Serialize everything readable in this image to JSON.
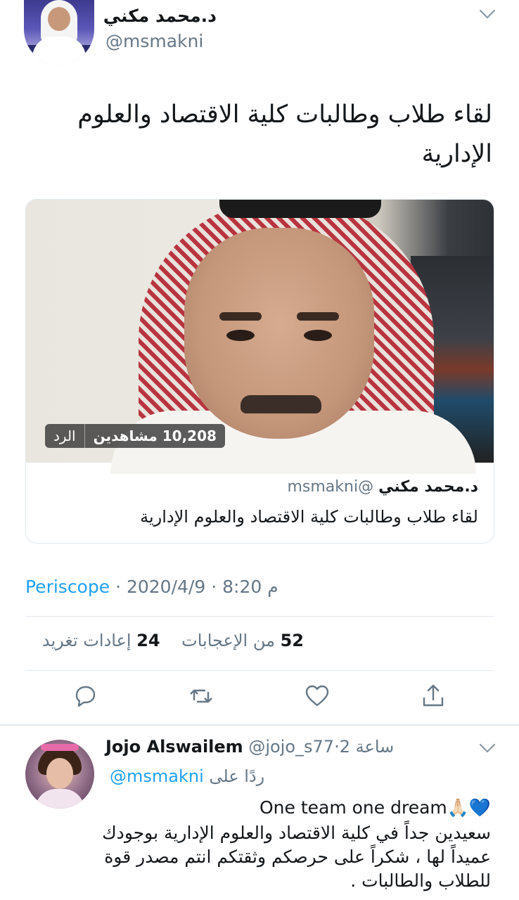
{
  "main_tweet": {
    "author_name": "د.محمد مكني",
    "author_handle": "@msmakni",
    "text": "لقاء طلاب وطالبات كلية الاقتصاد والعلوم الإدارية",
    "menu_icon": "chevron-down-icon"
  },
  "video_card": {
    "views": "10,208 مشاهدين",
    "reply_label": "الرد",
    "author_name": "د.محمد مكني",
    "author_handle": "@msmakni",
    "title": "لقاء طلاب وطالبات كلية الاقتصاد والعلوم الإدارية"
  },
  "meta": {
    "time": "8:20 م",
    "separator": "·",
    "date": "2020/4/9",
    "source": "Periscope"
  },
  "stats": {
    "likes_count": "52",
    "likes_label": "من الإعجابات",
    "retweets_count": "24",
    "retweets_label": "إعادات تغريد"
  },
  "actions": [
    {
      "icon": "reply-icon"
    },
    {
      "icon": "retweet-icon"
    },
    {
      "icon": "like-icon"
    },
    {
      "icon": "share-icon"
    }
  ],
  "reply": {
    "author_name": "Jojo Alswailem",
    "author_handle": "@jojo_s77",
    "separator": "·",
    "time": "2 ساعة",
    "replying_to_label": "ردًا على",
    "replying_to_handle": "@msmakni",
    "line1": "One team one dream🙏🏻💙",
    "body": "سعيدين جداً في كلية الاقتصاد والعلوم الإدارية بوجودك عميداً لها ، شكراً على حرصكم وثقتكم انتم مصدر قوة للطلاب والطالبات ."
  },
  "colors": {
    "accent": "#1da1f2",
    "secondary_text": "#657786",
    "divider": "#e1e8ed"
  }
}
